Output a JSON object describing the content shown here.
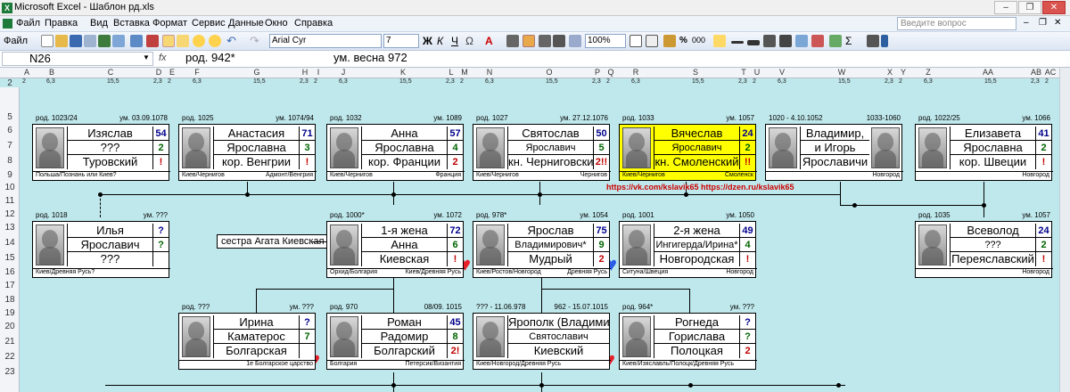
{
  "window": {
    "title": "Microsoft Excel - Шаблон рд.xls",
    "app_icon": "excel-icon"
  },
  "menu": [
    "Файл",
    "Правка",
    "Вид",
    "Вставка",
    "Формат",
    "Сервис",
    "Данные",
    "Окно",
    "Справка"
  ],
  "help_placeholder": "Введите вопрос",
  "toolbar": {
    "file_label": "Файл",
    "font": "Arial Cyr",
    "size": "7",
    "zoom": "100%"
  },
  "formula": {
    "cell": "N26",
    "fx": "fx",
    "text1": "род. 942*",
    "text2": "ум. весна 972"
  },
  "columns": [
    "A",
    "B",
    "C",
    "D",
    "E",
    "F",
    "G",
    "H",
    "I",
    "J",
    "K",
    "L",
    "M",
    "N",
    "O",
    "P",
    "Q",
    "R",
    "S",
    "T",
    "U",
    "V",
    "W",
    "X",
    "Y",
    "Z",
    "AA",
    "AB",
    "AC"
  ],
  "col_widths": [
    "2",
    "6,3",
    "15,5",
    "2,3",
    "2",
    "6,3",
    "15,5",
    "2,3",
    "2",
    "6,3",
    "15,5",
    "2,3",
    "2",
    "6,3",
    "15,5",
    "2,3",
    "2",
    "6,3",
    "15,5",
    "2,3",
    "2",
    "6,3",
    "15,5",
    "2,3",
    "2",
    "6,3",
    "15,5",
    "2,3",
    "2"
  ],
  "rows": [
    "2",
    "5",
    "6",
    "7",
    "8",
    "9",
    "10",
    "11",
    "12",
    "13",
    "14",
    "15",
    "16",
    "17",
    "18",
    "19",
    "20",
    "21",
    "22",
    "23"
  ],
  "links": {
    "vk": "https://vk.com/kslavik65",
    "dzen": "https://dzen.ru/kslavik65"
  },
  "callout": "сестра Агата Киевская",
  "cards": [
    {
      "id": "izyaslav",
      "top_left": "род. 1023/24",
      "top_right": "ум. 03.09.1078",
      "lines": [
        "Изяслав",
        "???",
        "Туровский"
      ],
      "nums": [
        "54",
        "2",
        "!"
      ],
      "colors": [
        "#00008b",
        "#006400",
        "#c00000"
      ],
      "bottom_left": "Польша/Познань или Киев?",
      "bottom_right": ""
    },
    {
      "id": "anastasia",
      "top_left": "род. 1025",
      "top_right": "ум. 1074/94",
      "lines": [
        "Анастасия",
        "Ярославна",
        "кор. Венгрии"
      ],
      "nums": [
        "71",
        "3",
        "!"
      ],
      "colors": [
        "#00008b",
        "#006400",
        "#c00000"
      ],
      "bottom_left": "Киев/Чернигов",
      "bottom_right": "Адмонт/Венгрия"
    },
    {
      "id": "anna",
      "top_left": "род. 1032",
      "top_right": "ум. 1089",
      "lines": [
        "Анна",
        "Ярославна",
        "кор. Франции"
      ],
      "nums": [
        "57",
        "4",
        "2"
      ],
      "colors": [
        "#00008b",
        "#006400",
        "#c00000"
      ],
      "bottom_left": "Киев/Чернигов",
      "bottom_right": "Франция"
    },
    {
      "id": "svyatoslav",
      "top_left": "род. 1027",
      "top_right": "ум. 27.12.1076",
      "lines": [
        "Святослав",
        "Ярославич",
        "кн. Черниговский"
      ],
      "nums": [
        "50",
        "5",
        "2!!"
      ],
      "colors": [
        "#00008b",
        "#006400",
        "#c00000"
      ],
      "bottom_left": "Киев/Чернигов",
      "bottom_right": "Чернигов"
    },
    {
      "id": "vyacheslav",
      "top_left": "род. 1033",
      "top_right": "ум. 1057",
      "lines": [
        "Вячеслав",
        "Ярославич",
        "кн. Смоленский"
      ],
      "nums": [
        "24",
        "2",
        "!!"
      ],
      "colors": [
        "#00008b",
        "#006400",
        "#c00000"
      ],
      "bottom_left": "Киев/Чернигов",
      "bottom_right": "Смоленск"
    },
    {
      "id": "vladimir",
      "top_left": "1020 - 4.10.1052",
      "top_right": "1033-1060",
      "lines": [
        "Владимир,",
        "и Игорь",
        "Ярославичи"
      ],
      "nums": [],
      "colors": [],
      "bottom_left": "",
      "bottom_right": "Новгород"
    },
    {
      "id": "elizaveta",
      "top_left": "род. 1022/25",
      "top_right": "ум. 1066",
      "lines": [
        "Елизавета",
        "Ярославна",
        "кор. Швеции"
      ],
      "nums": [
        "41",
        "2",
        "!"
      ],
      "colors": [
        "#00008b",
        "#006400",
        "#c00000"
      ],
      "bottom_left": "",
      "bottom_right": "Новгород"
    },
    {
      "id": "ilya",
      "top_left": "род. 1018",
      "top_right": "ум. ???",
      "lines": [
        "Илья",
        "Ярославич",
        "???"
      ],
      "nums": [
        "?",
        "?",
        ""
      ],
      "colors": [
        "#00008b",
        "#006400",
        "#c00000"
      ],
      "bottom_left": "Киев/Древняя Русь?",
      "bottom_right": ""
    },
    {
      "id": "wife1",
      "top_left": "род. 1000*",
      "top_right": "ум. 1072",
      "lines": [
        "1-я жена",
        "Анна",
        "Киевская"
      ],
      "nums": [
        "72",
        "6",
        "!"
      ],
      "colors": [
        "#00008b",
        "#006400",
        "#c00000"
      ],
      "bottom_left": "Орхид/Болгария",
      "bottom_right": "Киев/Древняя Русь"
    },
    {
      "id": "yaroslav",
      "top_left": "род. 978*",
      "top_right": "ум. 1054",
      "lines": [
        "Ярослав",
        "Владимирович*",
        "Мудрый"
      ],
      "nums": [
        "75",
        "9",
        "2"
      ],
      "colors": [
        "#00008b",
        "#006400",
        "#c00000"
      ],
      "bottom_left": "Киев/Ростов/Новгород",
      "bottom_right": "Древняя Русь"
    },
    {
      "id": "wife2",
      "top_left": "род. 1001",
      "top_right": "ум. 1050",
      "lines": [
        "2-я жена",
        "Ингигерда/Ирина*",
        "Новгородская"
      ],
      "nums": [
        "49",
        "4",
        "!"
      ],
      "colors": [
        "#00008b",
        "#006400",
        "#c00000"
      ],
      "bottom_left": "Ситуна/Швеция",
      "bottom_right": "Новгород"
    },
    {
      "id": "vsevolod",
      "top_left": "род. 1035",
      "top_right": "ум. 1057",
      "lines": [
        "Всеволод",
        "???",
        "Переяславский"
      ],
      "nums": [
        "24",
        "2",
        "!"
      ],
      "colors": [
        "#00008b",
        "#006400",
        "#c00000"
      ],
      "bottom_left": "",
      "bottom_right": "Новгород"
    },
    {
      "id": "irina",
      "top_left": "род. ???",
      "top_right": "ум. ???",
      "lines": [
        "Ирина",
        "Каматерос",
        "Болгарская"
      ],
      "nums": [
        "?",
        "7",
        ""
      ],
      "colors": [
        "#00008b",
        "#006400",
        "#c00000"
      ],
      "bottom_left": "",
      "bottom_right": "1е Болгарское царство"
    },
    {
      "id": "roman",
      "top_left": "род. 970",
      "top_right": "08/09. 1015",
      "lines": [
        "Роман",
        "Радомир",
        "Болгарский"
      ],
      "nums": [
        "45",
        "8",
        "2!"
      ],
      "colors": [
        "#00008b",
        "#006400",
        "#c00000"
      ],
      "bottom_left": "Болгария",
      "bottom_right": "Петерсик/Византия"
    },
    {
      "id": "yaropolk",
      "top_left": "??? - 11.06.978",
      "top_right": "962 - 15.07.1015",
      "lines": [
        "Ярополк (Владимир)",
        "Святославич",
        "Киевский"
      ],
      "nums": [],
      "colors": [],
      "bottom_left": "Киев/Новгород/Древняя Русь",
      "bottom_right": ""
    },
    {
      "id": "rogneda",
      "top_left": "род. 964*",
      "top_right": "ум. ???",
      "lines": [
        "Рогнеда",
        "Горислава",
        "Полоцкая"
      ],
      "nums": [
        "?",
        "?",
        "2"
      ],
      "colors": [
        "#00008b",
        "#006400",
        "#c00000"
      ],
      "bottom_left": "Киев/Изяславль/Полоцк/Древняя Русь",
      "bottom_right": ""
    }
  ]
}
